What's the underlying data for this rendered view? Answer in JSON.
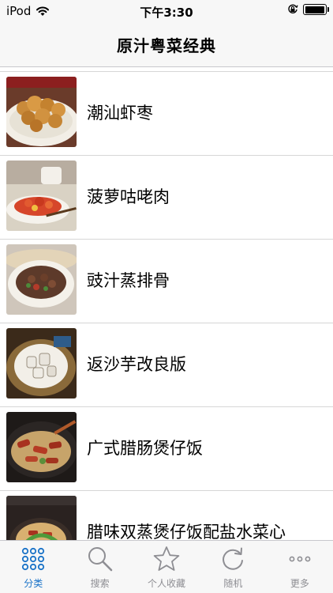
{
  "status_bar": {
    "carrier": "iPod",
    "time": "下午3:30"
  },
  "nav": {
    "title": "原汁粤菜经典"
  },
  "list": {
    "items": [
      {
        "label": "潮汕虾枣",
        "thumb": "fried-shrimp-balls"
      },
      {
        "label": "菠萝咕咾肉",
        "thumb": "sweet-sour-pork"
      },
      {
        "label": "豉汁蒸排骨",
        "thumb": "steamed-ribs"
      },
      {
        "label": "返沙芋改良版",
        "thumb": "sugar-taro"
      },
      {
        "label": "广式腊肠煲仔饭",
        "thumb": "clay-pot-rice"
      },
      {
        "label": "腊味双蒸煲仔饭配盐水菜心",
        "thumb": "claypot-rice-greens"
      }
    ]
  },
  "tab_bar": {
    "tabs": [
      {
        "label": "分类",
        "icon": "grid-dots-icon",
        "active": true
      },
      {
        "label": "搜索",
        "icon": "search-icon",
        "active": false
      },
      {
        "label": "个人收藏",
        "icon": "star-icon",
        "active": false
      },
      {
        "label": "随机",
        "icon": "refresh-icon",
        "active": false
      },
      {
        "label": "更多",
        "icon": "more-dots-icon",
        "active": false
      }
    ]
  },
  "colors": {
    "accent": "#1a73c8",
    "inactive": "#8e8e93",
    "bar_bg": "#f7f7f7"
  }
}
